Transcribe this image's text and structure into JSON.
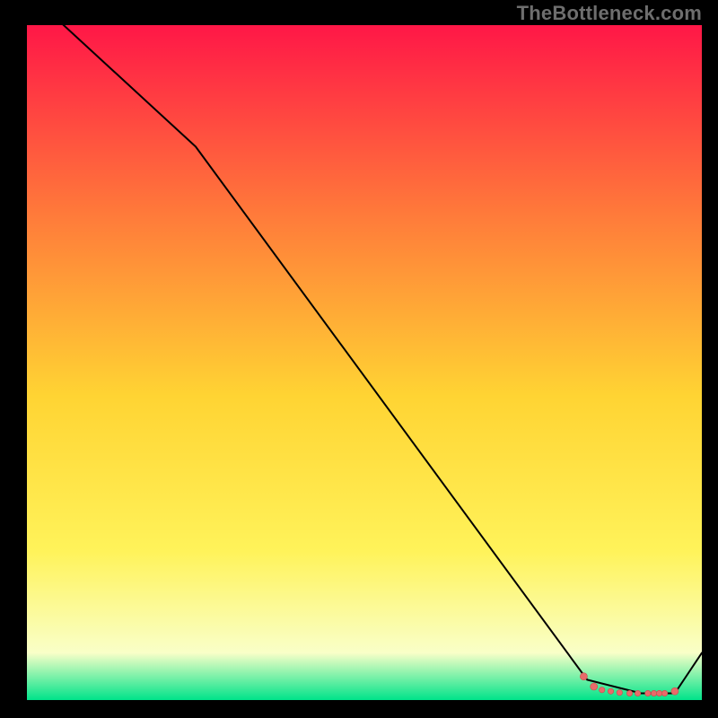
{
  "watermark": "TheBottleneck.com",
  "colors": {
    "background": "#000000",
    "gradient_top": "#ff1747",
    "gradient_mid_upper": "#ff7a3a",
    "gradient_mid": "#ffd433",
    "gradient_mid_lower": "#fff35a",
    "gradient_low": "#f9ffc8",
    "gradient_bottom": "#00e38a",
    "line": "#000000",
    "marker_fill": "#e86a6a",
    "marker_stroke": "#c94c4c"
  },
  "chart_data": {
    "type": "line",
    "title": "",
    "xlabel": "",
    "ylabel": "",
    "xlim": [
      0,
      100
    ],
    "ylim": [
      0,
      100
    ],
    "grid": false,
    "legend": false,
    "series": [
      {
        "name": "bottleneck-curve",
        "x": [
          0,
          25,
          83,
          91,
          96,
          100
        ],
        "y": [
          105,
          82,
          3,
          1,
          1,
          7
        ]
      }
    ],
    "markers": [
      {
        "name": "cluster-left-end",
        "x": 82.5,
        "y": 3.5,
        "r": 2.5
      },
      {
        "name": "cluster-a",
        "x": 84.0,
        "y": 2.0,
        "r": 2.5
      },
      {
        "name": "cluster-b",
        "x": 85.2,
        "y": 1.5,
        "r": 2.0
      },
      {
        "name": "cluster-c",
        "x": 86.5,
        "y": 1.3,
        "r": 2.0
      },
      {
        "name": "cluster-d",
        "x": 87.8,
        "y": 1.1,
        "r": 2.0
      },
      {
        "name": "gap-a",
        "x": 89.3,
        "y": 1.0,
        "r": 2.0
      },
      {
        "name": "gap-b",
        "x": 90.5,
        "y": 1.0,
        "r": 2.0
      },
      {
        "name": "mid-a",
        "x": 92.0,
        "y": 1.0,
        "r": 2.0
      },
      {
        "name": "mid-b",
        "x": 92.9,
        "y": 1.0,
        "r": 2.0
      },
      {
        "name": "mid-c",
        "x": 93.7,
        "y": 1.0,
        "r": 2.0
      },
      {
        "name": "mid-d",
        "x": 94.5,
        "y": 1.0,
        "r": 2.0
      },
      {
        "name": "end-a",
        "x": 96.0,
        "y": 1.3,
        "r": 2.5
      }
    ]
  }
}
